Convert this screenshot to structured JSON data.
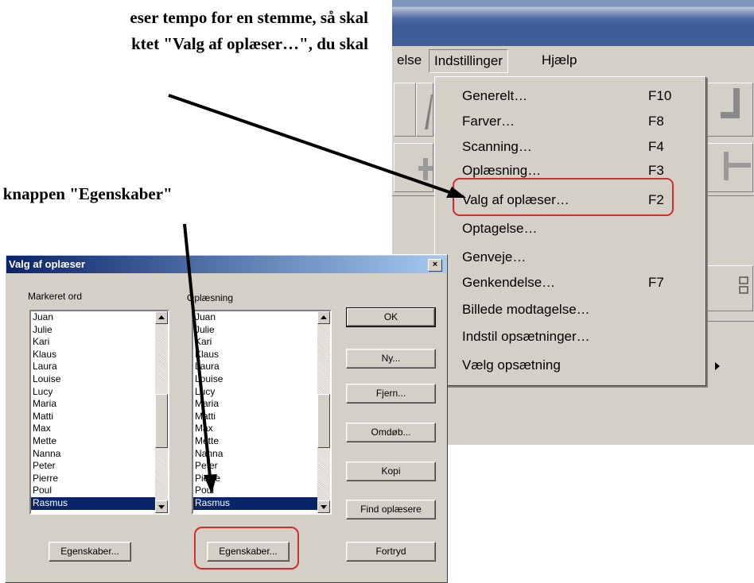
{
  "document": {
    "line1": "eser tempo for en stemme, så skal",
    "line2": "ktet \"Valg af oplæser…\", du skal",
    "line3": "å knappen \"Egenskaber\""
  },
  "app": {
    "menubar": {
      "optagelse_partial": "else",
      "indstillinger": "Indstillinger",
      "hjaelp": "Hjælp"
    },
    "dropdown": [
      {
        "label": "Generelt…",
        "key": "F10"
      },
      {
        "label": "Farver…",
        "key": "F8"
      },
      {
        "label": "Scanning…",
        "key": "F4"
      },
      {
        "label": "Oplæsning…",
        "key": "F3"
      },
      {
        "label": "Valg af oplæser…",
        "key": "F2"
      },
      {
        "label": "Optagelse…",
        "key": ""
      },
      {
        "label": "Genveje…",
        "key": ""
      },
      {
        "label": "Genkendelse…",
        "key": "F7"
      },
      {
        "label": "Billede modtagelse…",
        "key": ""
      },
      {
        "label": "Indstil opsætninger…",
        "key": ""
      },
      {
        "label": "Vælg opsætning",
        "key": ""
      }
    ]
  },
  "dialog": {
    "title": "Valg af oplæser",
    "close": "×",
    "left_label": "Markeret ord",
    "right_label": "Oplæsning",
    "names": [
      "Juan",
      "Julie",
      "Kari",
      "Klaus",
      "Laura",
      "Louise",
      "Lucy",
      "Maria",
      "Matti",
      "Max",
      "Mette",
      "Nanna",
      "Peter",
      "Pierre",
      "Poul",
      "Rasmus"
    ],
    "selected": "Rasmus",
    "buttons": {
      "ok": "OK",
      "ny": "Ny...",
      "fjern": "Fjern...",
      "omdob": "Omdøb...",
      "kopi": "Kopi",
      "find": "Find oplæsere",
      "fortryd": "Fortryd",
      "egenskaber_left": "Egenskaber...",
      "egenskaber_right": "Egenskaber..."
    }
  },
  "colors": {
    "highlight_red": "#d62b2b",
    "selection_blue": "#0a246a",
    "face_gray": "#d4d0c8"
  }
}
